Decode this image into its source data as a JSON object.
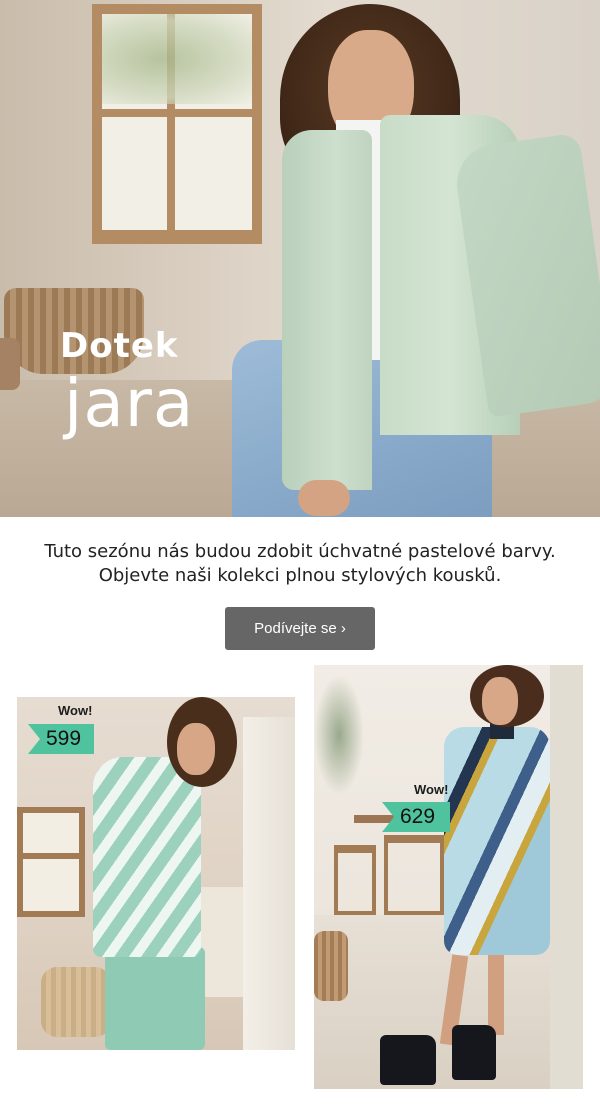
{
  "hero": {
    "title_line1": "Dotek",
    "title_line2": "jara"
  },
  "intro": {
    "line1": "Tuto sezónu nás budou zdobit úchvatné pastelové barvy.",
    "line2": "Objevte naši kolekci plnou stylových kousků."
  },
  "cta": {
    "label": "Podívejte se ›"
  },
  "products": [
    {
      "badge_label": "Wow!",
      "price": "599"
    },
    {
      "badge_label": "Wow!",
      "price": "629"
    }
  ],
  "colors": {
    "cta_background": "#666666",
    "price_tag": "#4fc29e",
    "hero_text": "#ffffff"
  }
}
